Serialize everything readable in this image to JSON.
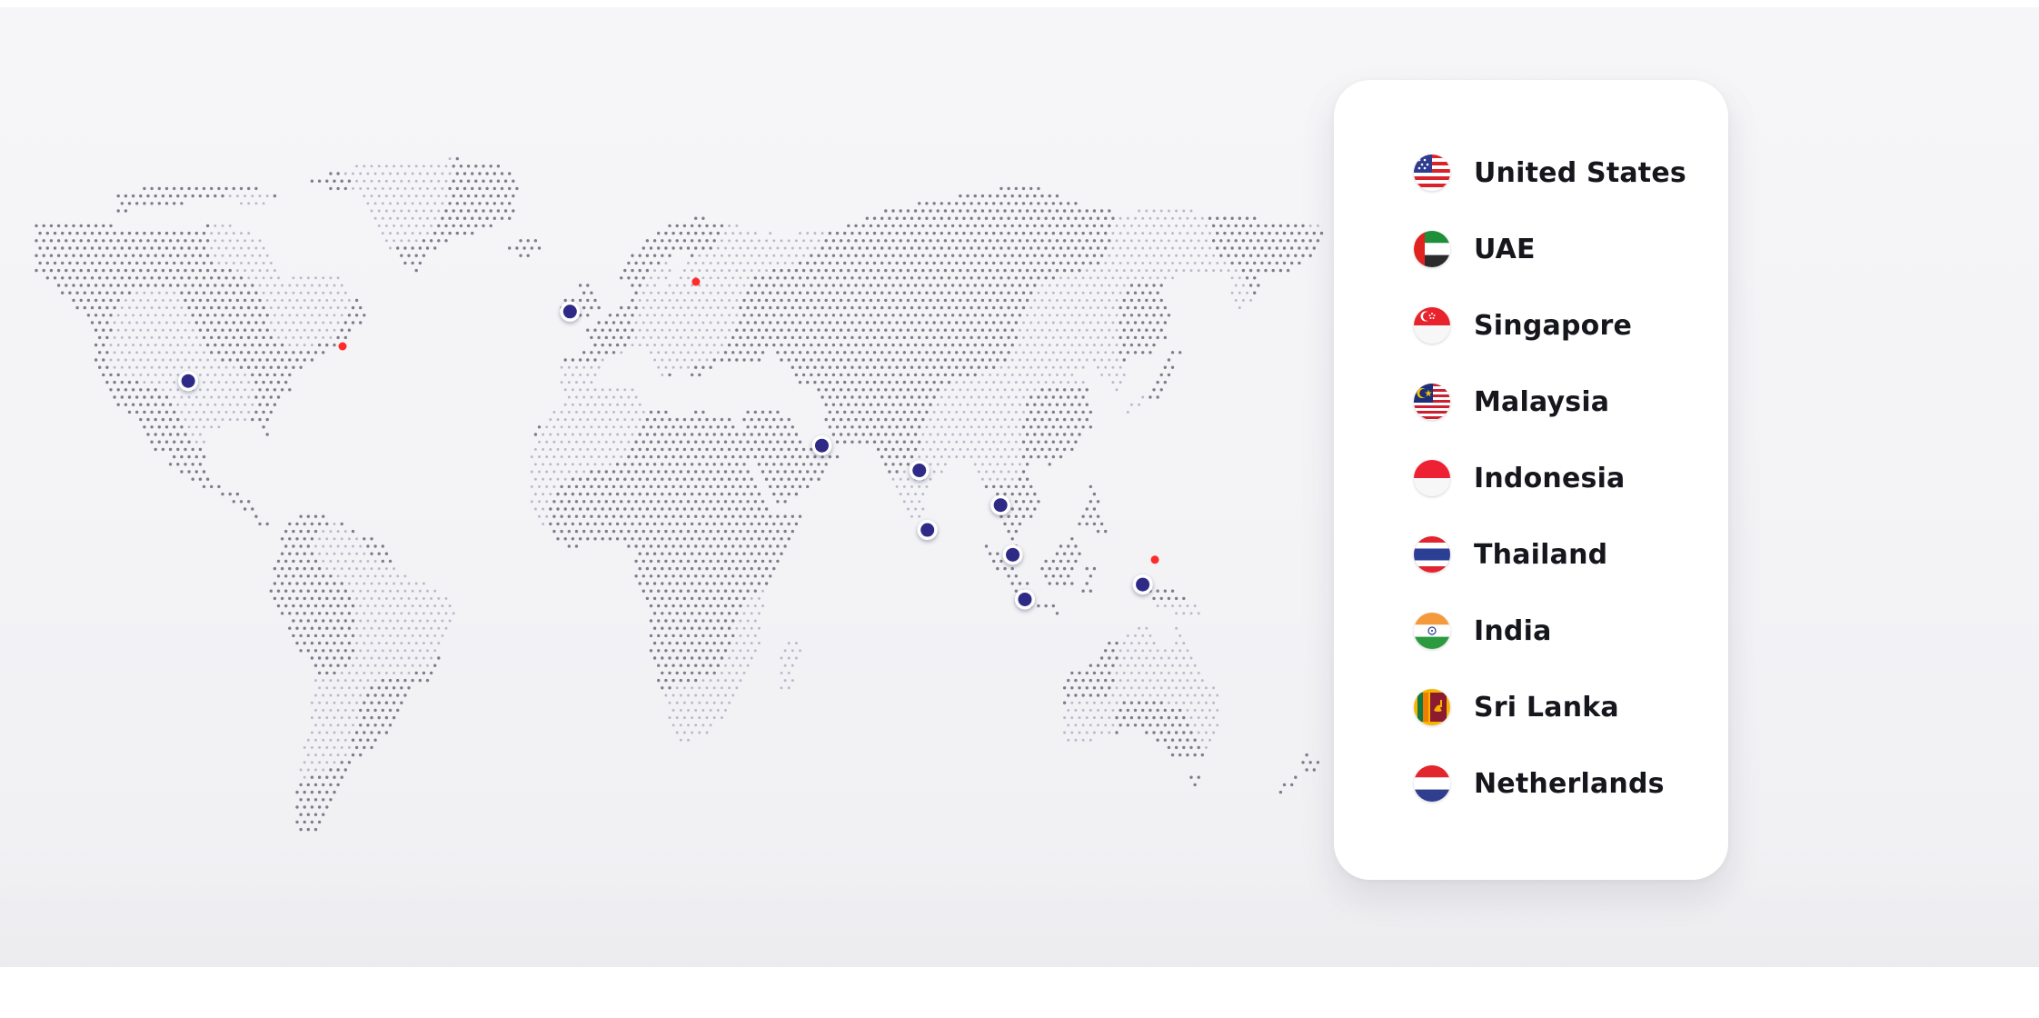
{
  "map": {
    "colors": {
      "land_dot": "#7d7d8c",
      "land_dot_light": "#b7b9cc",
      "office_marker": "#2f2a86",
      "office_ring": "#ffffff",
      "accent_marker": "#ff2a2a"
    },
    "markers": [
      {
        "kind": "office",
        "lon": -101,
        "lat": 38
      },
      {
        "kind": "accent",
        "lon": -63,
        "lat": 45
      },
      {
        "kind": "office",
        "lon": -7,
        "lat": 52
      },
      {
        "kind": "accent",
        "lon": 24,
        "lat": 58
      },
      {
        "kind": "office",
        "lon": 55,
        "lat": 25
      },
      {
        "kind": "office",
        "lon": 79,
        "lat": 20
      },
      {
        "kind": "office",
        "lon": 81,
        "lat": 8
      },
      {
        "kind": "office",
        "lon": 99,
        "lat": 13
      },
      {
        "kind": "office",
        "lon": 102,
        "lat": 3
      },
      {
        "kind": "office",
        "lon": 105,
        "lat": -6
      },
      {
        "kind": "office",
        "lon": 134,
        "lat": -3
      },
      {
        "kind": "accent",
        "lon": 137,
        "lat": 2
      }
    ]
  },
  "legend": {
    "items": [
      {
        "label": "United States",
        "flag": "us-flag-icon"
      },
      {
        "label": "UAE",
        "flag": "uae-flag-icon"
      },
      {
        "label": "Singapore",
        "flag": "singapore-flag-icon"
      },
      {
        "label": "Malaysia",
        "flag": "malaysia-flag-icon"
      },
      {
        "label": "Indonesia",
        "flag": "indonesia-flag-icon"
      },
      {
        "label": "Thailand",
        "flag": "thailand-flag-icon"
      },
      {
        "label": "India",
        "flag": "india-flag-icon"
      },
      {
        "label": "Sri Lanka",
        "flag": "sri-lanka-flag-icon"
      },
      {
        "label": "Netherlands",
        "flag": "netherlands-flag-icon"
      }
    ]
  }
}
